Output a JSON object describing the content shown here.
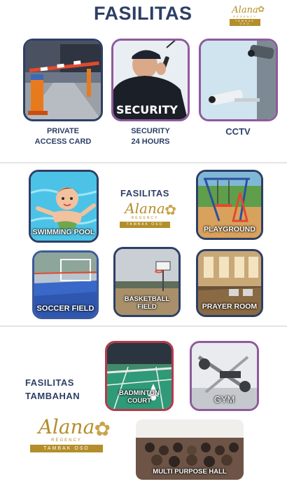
{
  "header": {
    "title": "FASILITAS"
  },
  "logo": {
    "name": "Alana",
    "sub": "REGENCY",
    "place": "TAMBAK OSO"
  },
  "section1": {
    "items": [
      {
        "caption_line1": "PRIVATE",
        "caption_line2": "ACCESS CARD"
      },
      {
        "caption_line1": "SECURITY",
        "caption_line2": "24 HOURS",
        "badge": "SECURITY"
      },
      {
        "caption_line1": "CCTV"
      }
    ]
  },
  "section2": {
    "title": "FASILITAS",
    "tiles": [
      {
        "label": "SWIMMING POOL"
      },
      {
        "label": "PLAYGROUND"
      },
      {
        "label": "SOCCER FIELD"
      },
      {
        "label": "BASKETBALL FIELD"
      },
      {
        "label": "PRAYER ROOM"
      }
    ]
  },
  "section3": {
    "title_line1": "FASILITAS",
    "title_line2": "TAMBAHAN",
    "tiles": [
      {
        "label": "BADMINTON COURT"
      },
      {
        "label": "GYM"
      },
      {
        "label": "MULTI PURPOSE HALL"
      }
    ]
  },
  "colors": {
    "navy": "#2e3f66",
    "gold": "#b48e2a",
    "purple": "#8e5a9b",
    "red": "#b53a4a"
  }
}
